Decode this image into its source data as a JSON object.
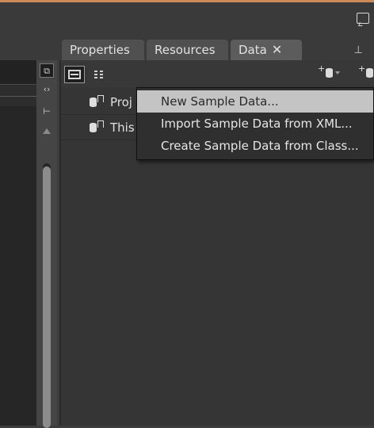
{
  "tabs": [
    {
      "label": "Properties"
    },
    {
      "label": "Resources"
    },
    {
      "label": "Data",
      "close": "✕"
    }
  ],
  "data_panel": {
    "rows": [
      {
        "label": "Proj"
      },
      {
        "label": "This"
      }
    ]
  },
  "context_menu": {
    "items": [
      {
        "label": "New Sample Data...",
        "highlighted": true
      },
      {
        "label": "Import Sample Data from XML..."
      },
      {
        "label": "Create Sample Data from Class..."
      }
    ]
  },
  "icons": {
    "top_right": "comment-icon",
    "pin": "pin-icon",
    "add_data_source": "add-data-source-icon",
    "add_live_data": "add-live-data-source-icon",
    "list_view": "list-view-icon",
    "tree_view": "details-view-icon"
  },
  "colors": {
    "accent": "#c88a56",
    "menu_highlight": "#c4c4c4"
  }
}
